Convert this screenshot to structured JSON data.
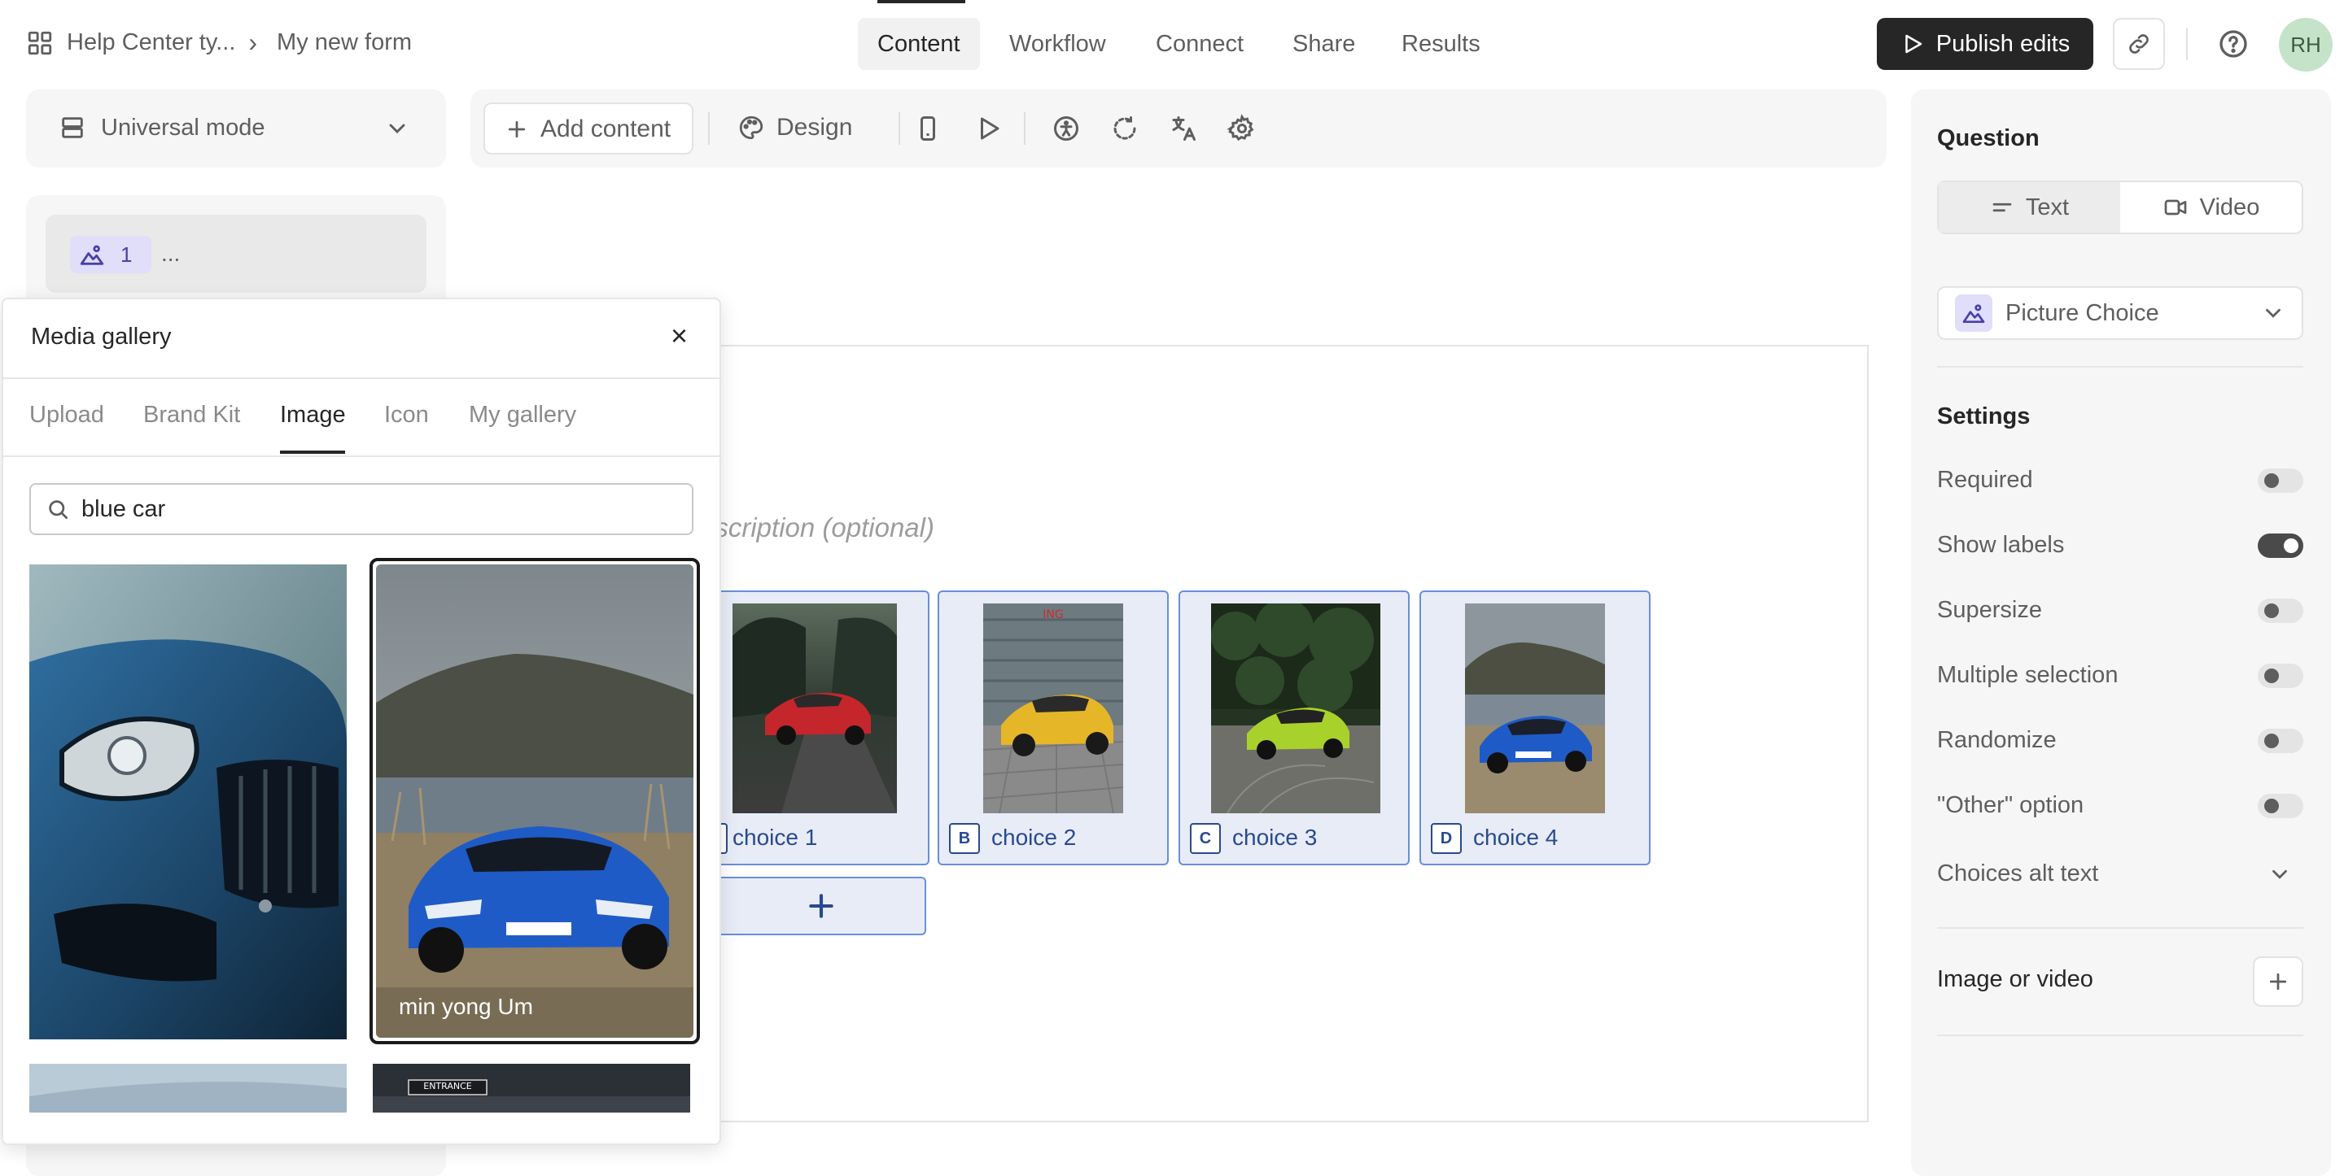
{
  "breadcrumb": {
    "workspace": "Help Center ty...",
    "separator": "›",
    "form": "My new form"
  },
  "nav": {
    "tabs": [
      {
        "label": "Content",
        "active": true
      },
      {
        "label": "Workflow",
        "active": false
      },
      {
        "label": "Connect",
        "active": false
      },
      {
        "label": "Share",
        "active": false
      },
      {
        "label": "Results",
        "active": false
      }
    ]
  },
  "header": {
    "publish_label": "Publish edits",
    "avatar_initials": "RH"
  },
  "left_panel": {
    "mode_label": "Universal mode",
    "question_number": "1",
    "question_title": "..."
  },
  "toolbar": {
    "add_content_label": "Add content",
    "design_label": "Design"
  },
  "canvas": {
    "description_placeholder": "escription (optional)",
    "choices": [
      {
        "key": "A",
        "label": "choice 1"
      },
      {
        "key": "B",
        "label": "choice 2"
      },
      {
        "key": "C",
        "label": "choice 3"
      },
      {
        "key": "D",
        "label": "choice 4"
      }
    ],
    "add_choice_symbol": "+"
  },
  "right_panel": {
    "question_heading": "Question",
    "text_label": "Text",
    "video_label": "Video",
    "question_type": "Picture Choice",
    "settings_heading": "Settings",
    "settings": [
      {
        "label": "Required",
        "on": false
      },
      {
        "label": "Show labels",
        "on": true
      },
      {
        "label": "Supersize",
        "on": false
      },
      {
        "label": "Multiple selection",
        "on": false
      },
      {
        "label": "Randomize",
        "on": false
      },
      {
        "label": "\"Other\" option",
        "on": false
      }
    ],
    "choices_alt_text_label": "Choices alt text",
    "image_or_video_label": "Image or video"
  },
  "media_gallery": {
    "title": "Media gallery",
    "close_symbol": "×",
    "tabs": [
      {
        "label": "Upload",
        "active": false
      },
      {
        "label": "Brand Kit",
        "active": false
      },
      {
        "label": "Image",
        "active": true
      },
      {
        "label": "Icon",
        "active": false
      },
      {
        "label": "My gallery",
        "active": false
      }
    ],
    "search_value": "blue car",
    "results": [
      {
        "caption": ""
      },
      {
        "caption": "min yong Um",
        "selected": true
      }
    ],
    "sign_text": "ENTRANCE"
  },
  "colors": {
    "accent_blue": "#294a8f",
    "choice_bg": "#e8ecf7",
    "choice_border": "#6a8fd8",
    "dark": "#262627"
  }
}
